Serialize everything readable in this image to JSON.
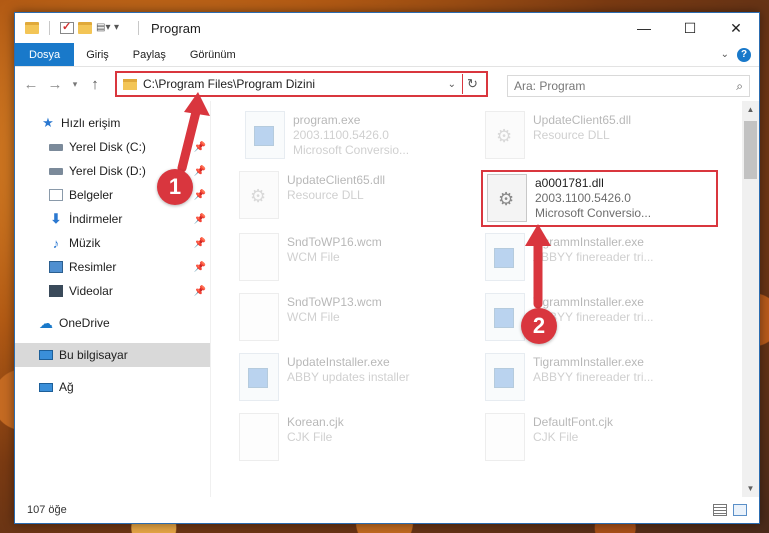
{
  "window": {
    "title": "Program",
    "controls": {
      "minimize": "—",
      "maximize": "☐",
      "close": "✕"
    }
  },
  "ribbon": {
    "tabs": [
      "Dosya",
      "Giriş",
      "Paylaş",
      "Görünüm"
    ]
  },
  "navbar": {
    "address": "C:\\Program Files\\Program Dizini",
    "search_placeholder": "Ara: Program"
  },
  "sidebar": {
    "quick_access": "Hızlı erişim",
    "items": [
      {
        "label": "Yerel Disk (C:)",
        "icon": "disk-icon",
        "pinned": true
      },
      {
        "label": "Yerel Disk (D:)",
        "icon": "disk-icon",
        "pinned": true
      },
      {
        "label": "Belgeler",
        "icon": "documents-icon",
        "pinned": true
      },
      {
        "label": "İndirmeler",
        "icon": "download-icon",
        "pinned": true
      },
      {
        "label": "Müzik",
        "icon": "music-icon",
        "pinned": true
      },
      {
        "label": "Resimler",
        "icon": "pictures-icon",
        "pinned": true
      },
      {
        "label": "Videolar",
        "icon": "videos-icon",
        "pinned": true
      }
    ],
    "onedrive": "OneDrive",
    "this_pc": "Bu bilgisayar",
    "network": "Ağ"
  },
  "files": [
    {
      "name": "program.exe",
      "line2": "2003.1100.5426.0",
      "line3": "Microsoft Conversio...",
      "icon": "exe-icon"
    },
    {
      "name": "UpdateClient65.dll",
      "line2": "Resource DLL",
      "line3": "",
      "icon": "dll-icon"
    },
    {
      "name": "UpdateClient65.dll",
      "line2": "Resource DLL",
      "line3": "",
      "icon": "dll-icon"
    },
    {
      "name": "a0001781.dll",
      "line2": "2003.1100.5426.0",
      "line3": "Microsoft Conversio...",
      "icon": "dll-icon"
    },
    {
      "name": "SndToWP16.wcm",
      "line2": "WCM File",
      "line3": "",
      "icon": "file-icon"
    },
    {
      "name": "TigrammInstaller.exe",
      "line2": "ABBYY finereader tri...",
      "line3": "",
      "icon": "exe-icon"
    },
    {
      "name": "SndToWP13.wcm",
      "line2": "WCM File",
      "line3": "",
      "icon": "file-icon"
    },
    {
      "name": "TigrammInstaller.exe",
      "line2": "ABBYY finereader tri...",
      "line3": "",
      "icon": "exe-icon"
    },
    {
      "name": "UpdateInstaller.exe",
      "line2": "ABBY updates installer",
      "line3": "",
      "icon": "exe-icon"
    },
    {
      "name": "TigrammInstaller.exe",
      "line2": "ABBYY finereader tri...",
      "line3": "",
      "icon": "exe-icon"
    },
    {
      "name": "Korean.cjk",
      "line2": "CJK File",
      "line3": "",
      "icon": "file-icon"
    },
    {
      "name": "DefaultFont.cjk",
      "line2": "CJK File",
      "line3": "",
      "icon": "file-icon"
    }
  ],
  "status": {
    "count": "107 öğe"
  },
  "annotations": {
    "badge1": "1",
    "badge2": "2"
  },
  "colors": {
    "accent": "#1979ca",
    "highlight": "#d9363e"
  }
}
